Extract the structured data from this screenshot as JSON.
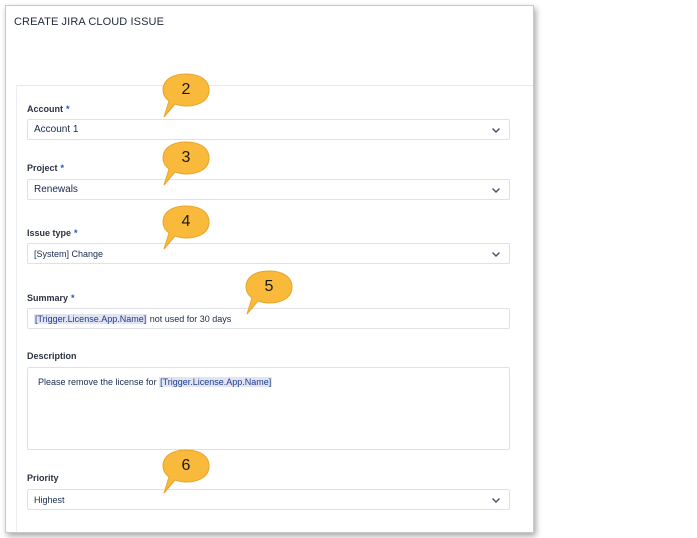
{
  "panel": {
    "title": "CREATE JIRA CLOUD ISSUE"
  },
  "form": {
    "account": {
      "label": "Account",
      "required_mark": "*",
      "value": "Account 1"
    },
    "project": {
      "label": "Project",
      "required_mark": "*",
      "value": "Renewals"
    },
    "issue_type": {
      "label": "Issue type",
      "required_mark": "*",
      "value": "[System] Change"
    },
    "summary": {
      "label": "Summary",
      "required_mark": "*",
      "token": "[Trigger.License.App.Name]",
      "rest": " not used for 30 days"
    },
    "description": {
      "label": "Description",
      "prefix": "Please remove the license for ",
      "token": "[Trigger.License.App.Name]"
    },
    "priority": {
      "label": "Priority",
      "value": "Highest"
    }
  },
  "callouts": [
    "2",
    "3",
    "4",
    "5",
    "6"
  ],
  "colors": {
    "callout_fill": "#f9b93a",
    "required": "#1a56c4",
    "token_bg": "#e2e5f1"
  }
}
